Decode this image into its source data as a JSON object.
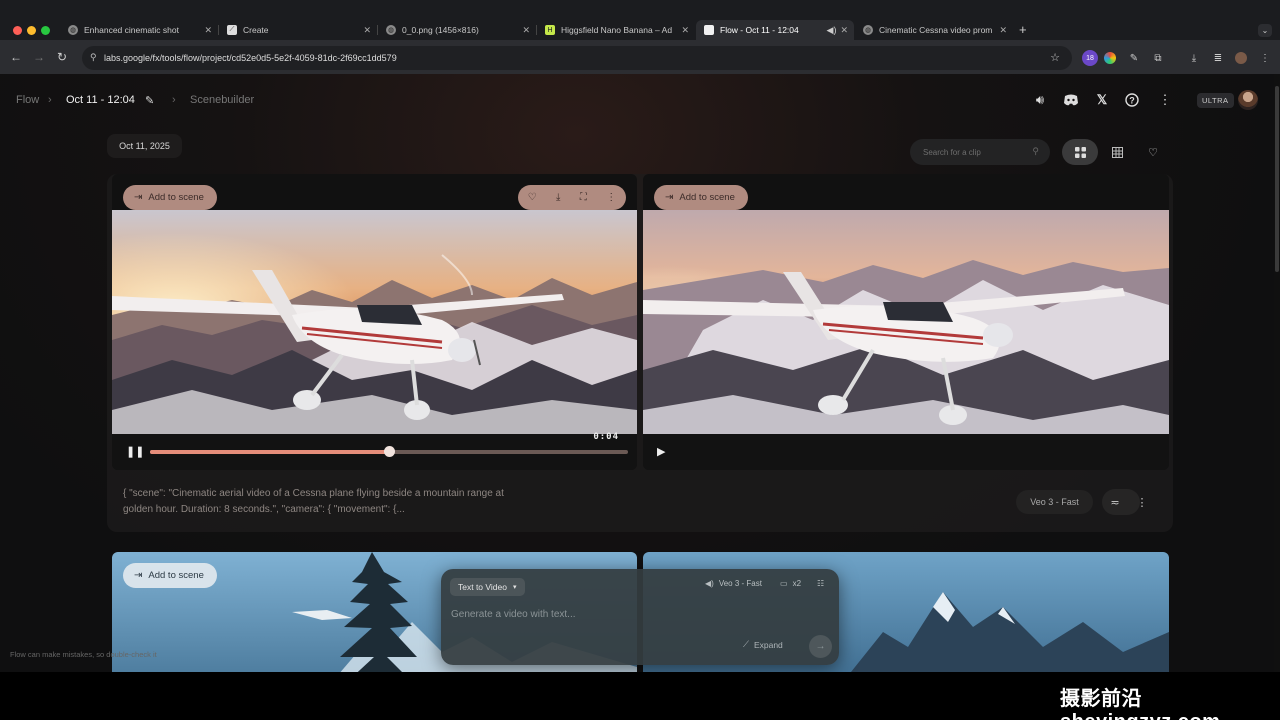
{
  "browser": {
    "tabs": [
      {
        "label": "Enhanced cinematic shot",
        "active": false
      },
      {
        "label": "Create",
        "active": false
      },
      {
        "label": "0_0.png (1456×816)",
        "active": false
      },
      {
        "label": "Higgsfield Nano Banana – Ad",
        "active": false
      },
      {
        "label": "Flow - Oct 11 - 12:04",
        "active": true
      },
      {
        "label": "Cinematic Cessna video prom",
        "active": false
      }
    ],
    "new_tab": "+",
    "url": "labs.google/fx/tools/flow/project/cd52e0d5-5e2f-4059-81dc-2f69cc1dd579",
    "extension_badge": "18"
  },
  "header": {
    "crumb_root": "Flow",
    "crumb_project": "Oct 11 - 12:04",
    "crumb_page": "Scenebuilder",
    "plan_badge": "ULTRA"
  },
  "toolbar": {
    "date": "Oct 11, 2025",
    "search_placeholder": "Search for a clip"
  },
  "clips": [
    {
      "add_label": "Add to scene",
      "time": "0:04",
      "progress": 0.5,
      "playing": true
    },
    {
      "add_label": "Add to scene",
      "playing": false
    }
  ],
  "clip_prompt": "{ \"scene\": \"Cinematic aerial video of a Cessna plane flying beside a mountain range at golden hour. Duration: 8 seconds.\", \"camera\": { \"movement\": {...",
  "clip_model": "Veo 3 - Fast",
  "second_group": {
    "add_label": "Add to scene"
  },
  "composer": {
    "mode": "Text to Video",
    "model": "Veo 3 - Fast",
    "count": "x2",
    "placeholder": "Generate a video with text...",
    "expand": "Expand"
  },
  "disclaimer": "Flow can make mistakes, so double-check it",
  "watermark": "摄影前沿sheyingzyz.com",
  "colors": {
    "accent": "#e58d7a",
    "chip": "#be968a",
    "background": "#0f0f10"
  }
}
